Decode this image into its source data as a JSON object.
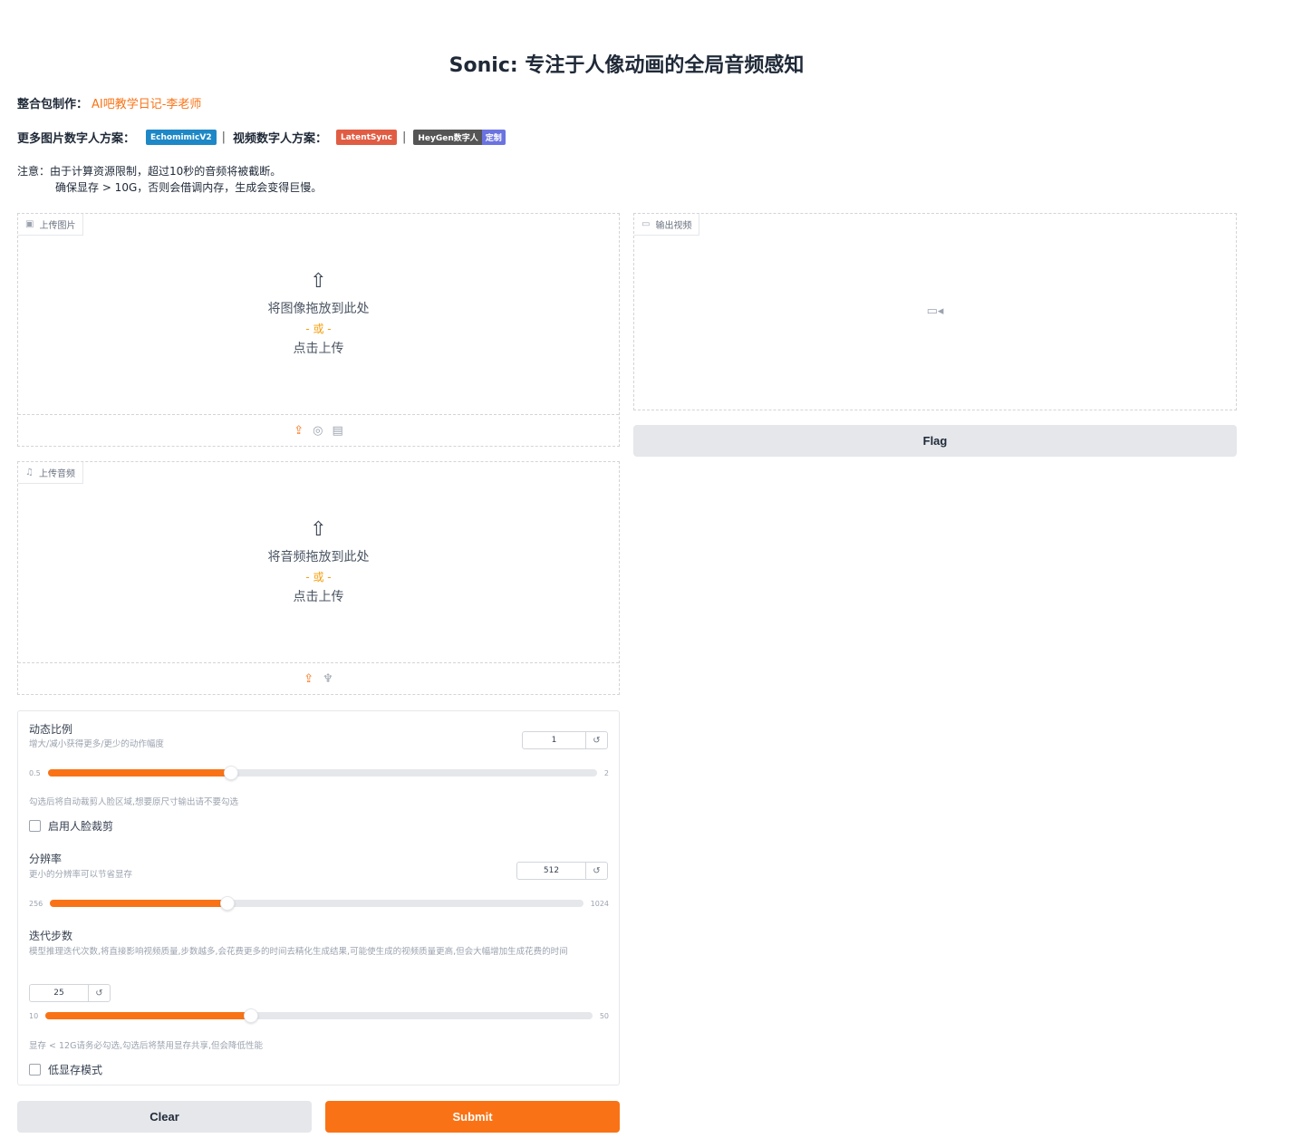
{
  "title": "Sonic: 专注于人像动画的全局音频感知",
  "credit": {
    "label": "整合包制作：",
    "author": "AI吧教学日记-李老师"
  },
  "more": {
    "image_label": "更多图片数字人方案：",
    "badge_echo": "EchomimicV2",
    "sep1": "|",
    "video_label": "视频数字人方案：",
    "badge_latent": "LatentSync",
    "sep2": "|",
    "badge_heygen": "HeyGen数字人",
    "badge_custom": "定制",
    "colors": {
      "echo": "#1e88c7",
      "latent": "#e05d44",
      "heygen": "#555555",
      "custom": "#6b73e0"
    }
  },
  "notice": {
    "line1": "注意：由于计算资源限制，超过10秒的音频将被截断。",
    "line2": "确保显存 > 10G，否则会借调内存，生成会变得巨慢。"
  },
  "image_upload": {
    "label": "上传图片",
    "icon": "image-icon",
    "drop_text": "将图像拖放到此处",
    "or_text": "- 或 -",
    "click_text": "点击上传",
    "tools": [
      "upload-icon",
      "webcam-icon",
      "clipboard-icon"
    ]
  },
  "audio_upload": {
    "label": "上传音频",
    "icon": "music-icon",
    "drop_text": "将音频拖放到此处",
    "or_text": "- 或 -",
    "click_text": "点击上传",
    "tools": [
      "upload-icon",
      "microphone-icon"
    ]
  },
  "output_video": {
    "label": "输出视频",
    "icon": "video-icon"
  },
  "flag_label": "Flag",
  "params": {
    "motion": {
      "label": "动态比例",
      "desc": "增大/减小获得更多/更少的动作幅度",
      "value": "1",
      "min": "0.5",
      "max": "2",
      "fraction": 0.333
    },
    "crop_hint": "勾选后将自动裁剪人脸区域,想要原尺寸输出请不要勾选",
    "crop_label": "启用人脸裁剪",
    "resolution": {
      "label": "分辨率",
      "desc": "更小的分辨率可以节省显存",
      "value": "512",
      "min": "256",
      "max": "1024",
      "fraction": 0.333
    },
    "steps": {
      "label": "迭代步数",
      "desc": "模型推理迭代次数,将直接影响视频质量,步数越多,会花费更多的时间去精化生成结果,可能使生成的视频质量更高,但会大幅增加生成花费的时间",
      "value": "25",
      "min": "10",
      "max": "50",
      "fraction": 0.375
    },
    "lowmem_hint": "显存 < 12G请务必勾选,勾选后将禁用显存共享,但会降低性能",
    "lowmem_label": "低显存模式"
  },
  "clear_label": "Clear",
  "submit_label": "Submit",
  "accent": "#f97316"
}
